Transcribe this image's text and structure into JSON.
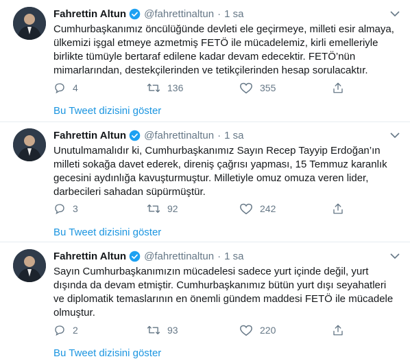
{
  "tweets": [
    {
      "name": "Fahrettin Altun",
      "handle": "@fahrettinaltun",
      "separator": "·",
      "time": "1 sa",
      "text": "Cumhurbaşkanımız öncülüğünde devleti ele geçirmeye, milleti esir almaya,\nülkemizi işgal etmeye azmetmiş FETÖ ile mücadelemiz, kirli emelleriyle\nbirlikte tümüyle bertaraf edilene kadar devam edecektir. FETÖ’nün\nmimarlarından, destekçilerinden ve tetikçilerinden hesap sorulacaktır.",
      "replies": "4",
      "retweets": "136",
      "likes": "355",
      "thread_link": "Bu Tweet dizisini göster"
    },
    {
      "name": "Fahrettin Altun",
      "handle": "@fahrettinaltun",
      "separator": "·",
      "time": "1 sa",
      "text": "Unutulmamalıdır ki, Cumhurbaşkanımız Sayın Recep Tayyip Erdoğan’ın\nmilleti sokağa davet ederek, direniş çağrısı yapması, 15 Temmuz karanlık\ngecesini aydınlığa kavuşturmuştur. Milletiyle omuz omuza veren lider,\ndarbecileri sahadan süpürmüştür.",
      "replies": "3",
      "retweets": "92",
      "likes": "242",
      "thread_link": "Bu Tweet dizisini göster"
    },
    {
      "name": "Fahrettin Altun",
      "handle": "@fahrettinaltun",
      "separator": "·",
      "time": "1 sa",
      "text": "Sayın Cumhurbaşkanımızın mücadelesi sadece yurt içinde değil, yurt\ndışında da devam etmiştir. Cumhurbaşkanımız bütün yurt dışı seyahatleri\nve diplomatik temaslarının en önemli gündem maddesi FETÖ ile mücadele\nolmuştur.",
      "replies": "2",
      "retweets": "93",
      "likes": "220",
      "thread_link": "Bu Tweet dizisini göster"
    }
  ],
  "colors": {
    "link": "#1b95e0",
    "muted": "#657786",
    "verified": "#1da1f2",
    "divider": "#e6ecf0"
  },
  "icons": [
    "avatar",
    "verified-badge-icon",
    "chevron-down-icon",
    "reply-icon",
    "retweet-icon",
    "like-icon",
    "share-icon"
  ]
}
